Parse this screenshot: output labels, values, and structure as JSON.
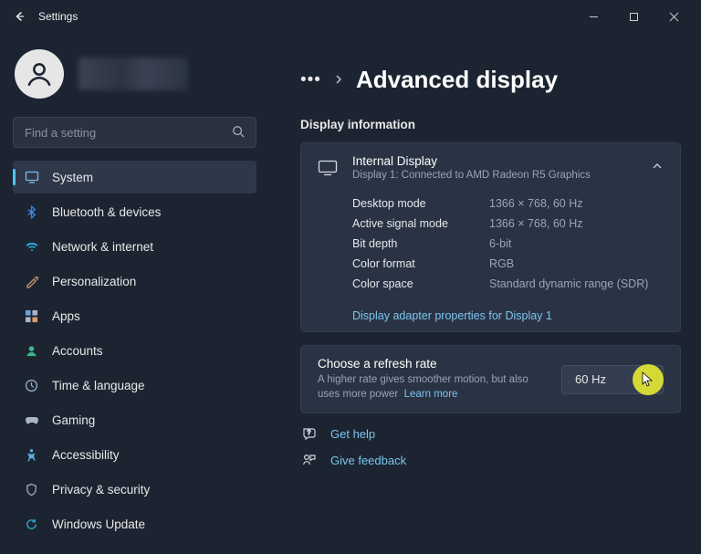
{
  "titlebar": {
    "title": "Settings"
  },
  "search": {
    "placeholder": "Find a setting"
  },
  "nav": {
    "items": [
      {
        "label": "System",
        "icon": "system"
      },
      {
        "label": "Bluetooth & devices",
        "icon": "bluetooth"
      },
      {
        "label": "Network & internet",
        "icon": "network"
      },
      {
        "label": "Personalization",
        "icon": "personalization"
      },
      {
        "label": "Apps",
        "icon": "apps"
      },
      {
        "label": "Accounts",
        "icon": "accounts"
      },
      {
        "label": "Time & language",
        "icon": "time"
      },
      {
        "label": "Gaming",
        "icon": "gaming"
      },
      {
        "label": "Accessibility",
        "icon": "accessibility"
      },
      {
        "label": "Privacy & security",
        "icon": "privacy"
      },
      {
        "label": "Windows Update",
        "icon": "update"
      }
    ],
    "selected_index": 0
  },
  "breadcrumb": {
    "page_title": "Advanced display"
  },
  "section": {
    "title": "Display information"
  },
  "display_card": {
    "title": "Internal Display",
    "subtitle": "Display 1: Connected to AMD Radeon R5 Graphics",
    "rows": [
      {
        "label": "Desktop mode",
        "value": "1366 × 768, 60 Hz"
      },
      {
        "label": "Active signal mode",
        "value": "1366 × 768, 60 Hz"
      },
      {
        "label": "Bit depth",
        "value": "6-bit"
      },
      {
        "label": "Color format",
        "value": "RGB"
      },
      {
        "label": "Color space",
        "value": "Standard dynamic range (SDR)"
      }
    ],
    "adapter_link": "Display adapter properties for Display 1"
  },
  "refresh_card": {
    "title": "Choose a refresh rate",
    "subtitle_a": "A higher rate gives smoother motion, but also uses more power",
    "learn_more": "Learn more",
    "value": "60 Hz"
  },
  "footer": {
    "help": "Get help",
    "feedback": "Give feedback"
  }
}
